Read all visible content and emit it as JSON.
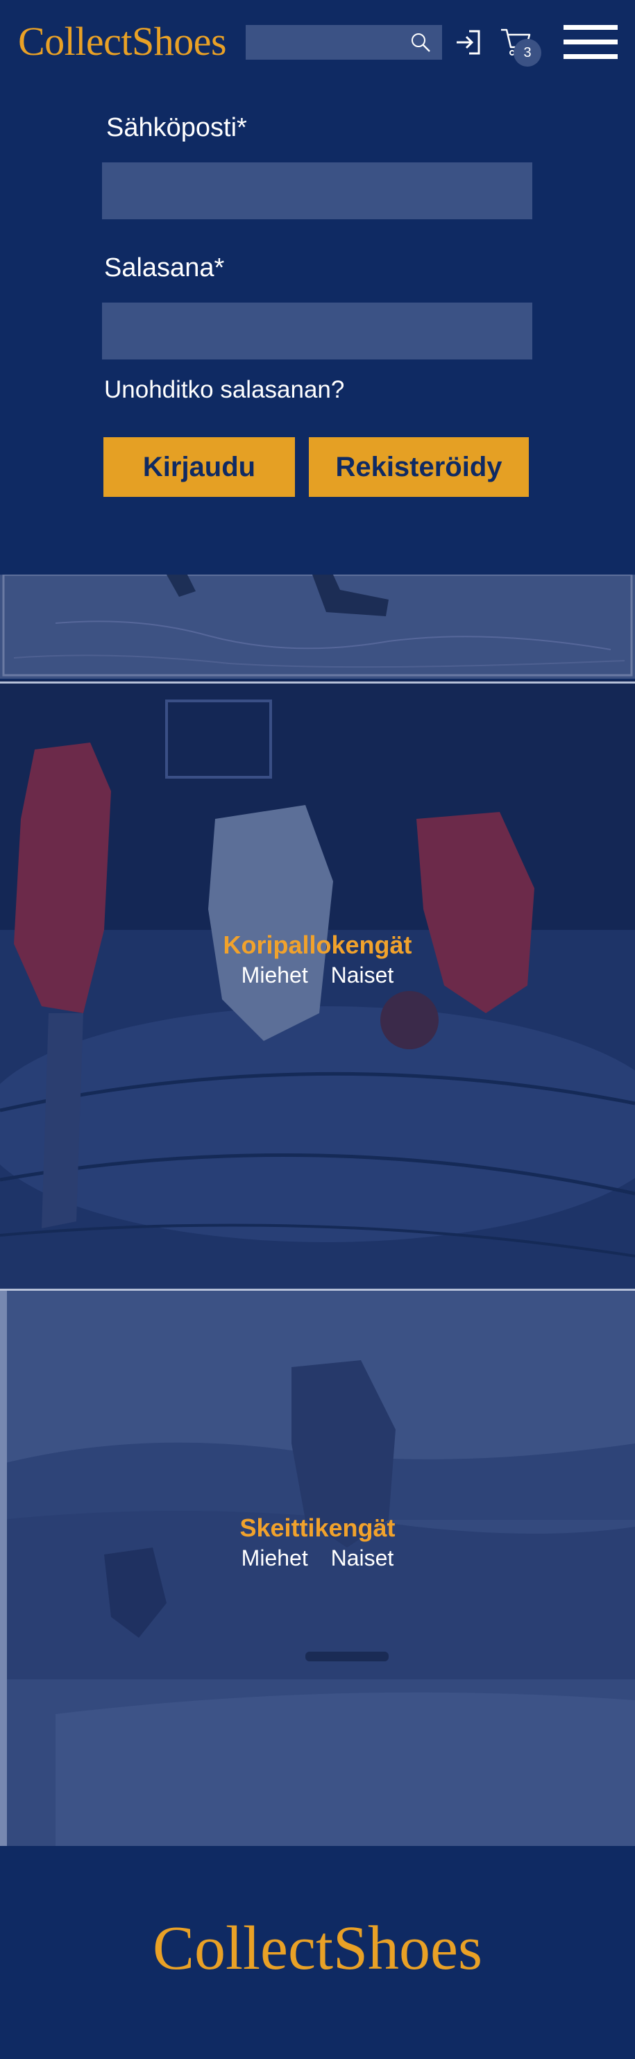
{
  "header": {
    "logo": "CollectShoes",
    "search_placeholder": "",
    "search_icon": "search-icon",
    "login_icon": "login-icon",
    "cart_icon": "shopping-cart-icon",
    "cart_count": "3",
    "menu_icon": "hamburger-menu-icon"
  },
  "login_form": {
    "email_label": "Sähköposti*",
    "email_value": "",
    "password_label": "Salasana*",
    "password_value": "",
    "forgot_password": "Unohditko salasanan?",
    "login_button": "Kirjaudu",
    "register_button": "Rekisteröidy"
  },
  "categories": [
    {
      "title": "Koripallokengät",
      "links": [
        "Miehet",
        "Naiset"
      ]
    },
    {
      "title": "Skeittikengät",
      "links": [
        "Miehet",
        "Naiset"
      ]
    }
  ],
  "footer": {
    "logo": "CollectShoes"
  },
  "colors": {
    "navy": "#0f2a63",
    "accent": "#e5a024",
    "input": "#3b5285",
    "white": "#ffffff"
  }
}
